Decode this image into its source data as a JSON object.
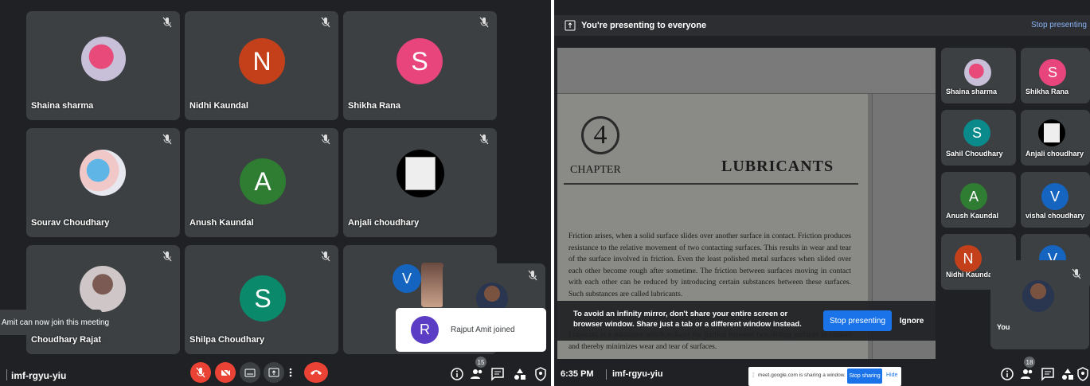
{
  "left": {
    "tiles": [
      {
        "name": "Shaina sharma"
      },
      {
        "name": "Nidhi Kaundal",
        "initial": "N",
        "color": "#c4401b"
      },
      {
        "name": "Shikha Rana",
        "initial": "S",
        "color": "#e8457c"
      },
      {
        "name": "Sourav Choudhary"
      },
      {
        "name": "Anush Kaundal",
        "initial": "A",
        "color": "#2e7d32"
      },
      {
        "name": "Anjali choudhary"
      },
      {
        "name": "Choudhary Rajat"
      },
      {
        "name": "Shilpa Choudhary",
        "initial": "S",
        "color": "#0a8a6a"
      },
      {
        "initial": "V",
        "color": "#1565c0"
      }
    ],
    "toast": "Amit can now join this meeting",
    "join_notice": {
      "initial": "R",
      "color": "#5b3cc4",
      "text": "Rajput Amit joined"
    },
    "meeting_code": "imf-rgyu-yiu",
    "participants_count": "15"
  },
  "right": {
    "banner": "You're presenting to everyone",
    "stop_link": "Stop presenting",
    "slide": {
      "number": "4",
      "chapter": "CHAPTER",
      "title": "LUBRICANTS",
      "para1": "Friction arises, when a solid surface slides over another surface in contact. Friction produces resistance to the relative movement of two contacting surfaces. This results in wear and tear of the surface involved in friction. Even the least polished metal surfaces when slided over each other become rough after sometime. The friction between surfaces moving in contact with each other can be reduced by introducing certain substances between these surfaces. Such substances are called lubricants.",
      "para2": "Lubricant is a substance which reduces the friction between two sliding surfaces in contact and thereby minimizes wear and tear of surfaces."
    },
    "warning": "To avoid an infinity mirror, don't share your entire screen or browser window. Share just a tab or a different window instead.",
    "stop_button": "Stop presenting",
    "ignore_button": "Ignore",
    "tiles": [
      {
        "name": "Shaina sharma"
      },
      {
        "name": "Shikha Rana",
        "initial": "S",
        "color": "#e8457c"
      },
      {
        "name": "Sahil Choudhary",
        "initial": "S",
        "color": "#0a8a8a"
      },
      {
        "name": "Anjali choudhary"
      },
      {
        "name": "Anush Kaundal",
        "initial": "A",
        "color": "#2e7d32"
      },
      {
        "name": "vishal choudhary",
        "initial": "V",
        "color": "#1565c0"
      },
      {
        "name": "Nidhi Kaundal",
        "initial": "N",
        "color": "#c4401b"
      },
      {
        "initial": "V",
        "color": "#1565c0"
      }
    ],
    "self_label": "You",
    "time": "6:35 PM",
    "meeting_code": "imf-rgyu-yiu",
    "participants_count": "18",
    "share_bar": {
      "text": "meet.google.com is sharing a window.",
      "stop": "Stop sharing",
      "hide": "Hide"
    }
  }
}
